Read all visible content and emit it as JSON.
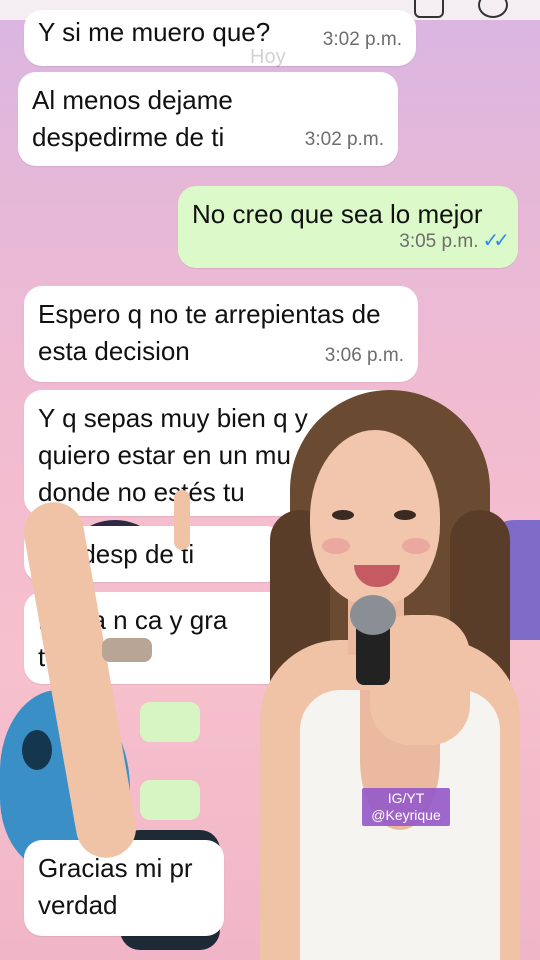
{
  "day_label": "Hoy",
  "messages": [
    {
      "id": "m1",
      "direction": "incoming",
      "text": "Y si me muero que?",
      "time": "3:02 p.m."
    },
    {
      "id": "m2",
      "direction": "incoming",
      "text": "Al menos dejame\ndespedirme de ti",
      "time": "3:02 p.m."
    },
    {
      "id": "m3",
      "direction": "outgoing",
      "text": "No creo que sea lo mejor",
      "time": "3:05 p.m.",
      "status": "read"
    },
    {
      "id": "m4",
      "direction": "incoming",
      "text": "Espero q no te arrepientas de\nesta decision",
      "time": "3:06 p.m."
    },
    {
      "id": "m5",
      "direction": "incoming",
      "text": "Y q sepas muy bien q y\nquiero estar en un mu\ndonde no estés tu",
      "time": ""
    },
    {
      "id": "m6",
      "direction": "incoming",
      "text": "Me desp     de ti",
      "time": ""
    },
    {
      "id": "m7",
      "direction": "incoming",
      "text": "Hasta n    ca y gra\ntodo",
      "time": ""
    },
    {
      "id": "m8",
      "direction": "incoming",
      "text": "Gracias mi pr\nverdad",
      "time": ""
    }
  ],
  "watermark": {
    "line1": "IG/YT",
    "line2": "@Keyrique"
  },
  "colors": {
    "incoming_bubble": "#ffffff",
    "outgoing_bubble": "#dcf9c9",
    "read_ticks": "#2d8cf0",
    "watermark_bg": "#9a5ac8"
  },
  "icons": {
    "read_receipt": "double-check-icon",
    "video_call": "video-icon",
    "voice_call": "phone-icon"
  }
}
